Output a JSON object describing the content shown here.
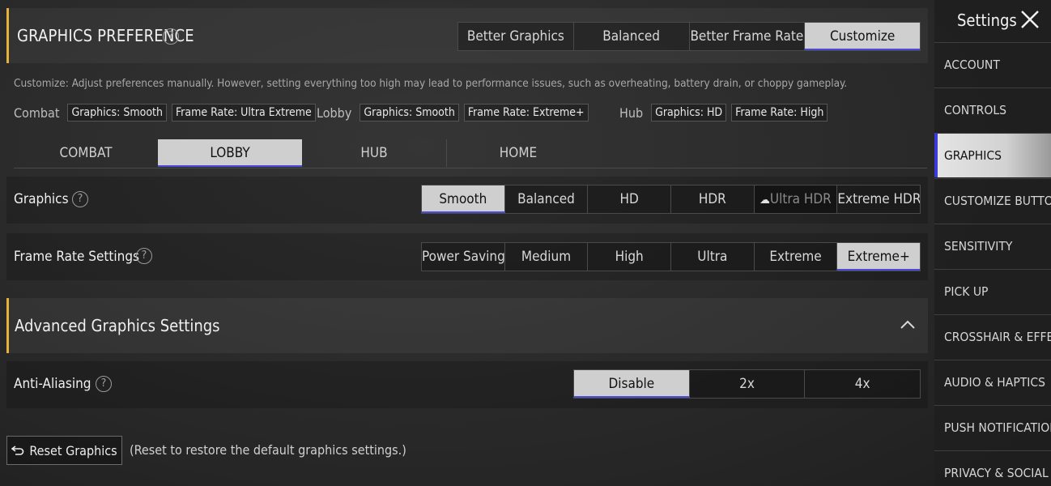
{
  "preference": {
    "title": "GRAPHICS PREFERENCE",
    "options": [
      "Better Graphics",
      "Balanced",
      "Better Frame Rate",
      "Customize"
    ],
    "selected": "Customize",
    "description": "Customize: Adjust preferences manually. However, setting everything too high may lead to performance issues, such as overheating, battery drain, or choppy gameplay."
  },
  "summary": {
    "combat_label": "Combat",
    "combat_graphics": "Graphics: Smooth",
    "combat_frame": "Frame Rate: Ultra Extreme",
    "lobby_label": "Lobby",
    "lobby_graphics": "Graphics: Smooth",
    "lobby_frame": "Frame Rate: Extreme+",
    "hub_label": "Hub",
    "hub_graphics": "Graphics: HD",
    "hub_frame": "Frame Rate: High"
  },
  "tabs": [
    "COMBAT",
    "LOBBY",
    "HUB",
    "HOME"
  ],
  "selected_tab": "LOBBY",
  "graphics": {
    "label": "Graphics",
    "options": [
      "Smooth",
      "Balanced",
      "HD",
      "HDR",
      "Ultra HDR",
      "Extreme HDR"
    ],
    "selected": "Smooth",
    "locked": "Ultra HDR"
  },
  "frame_rate": {
    "label": "Frame Rate Settings",
    "options": [
      "Power Saving",
      "Medium",
      "High",
      "Ultra",
      "Extreme",
      "Extreme+"
    ],
    "selected": "Extreme+"
  },
  "advanced": {
    "title": "Advanced Graphics Settings"
  },
  "anti_aliasing": {
    "label": "Anti-Aliasing",
    "options": [
      "Disable",
      "2x",
      "4x"
    ],
    "selected": "Disable"
  },
  "reset": {
    "label": "Reset Graphics",
    "note": "(Reset to restore the default graphics settings.)"
  },
  "sidebar": {
    "title": "Settings",
    "items": [
      "ACCOUNT",
      "CONTROLS",
      "GRAPHICS",
      "CUSTOMIZE BUTTONS",
      "SENSITIVITY",
      "PICK UP",
      "CROSSHAIR & EFFECT",
      "AUDIO & HAPTICS",
      "PUSH NOTIFICATIONS",
      "PRIVACY & SOCIAL"
    ],
    "selected": "GRAPHICS"
  },
  "colors": {
    "accent": "#e6b23a",
    "selected_bg": "#cfcfcf",
    "selected_underline": "#4b4bd6"
  }
}
